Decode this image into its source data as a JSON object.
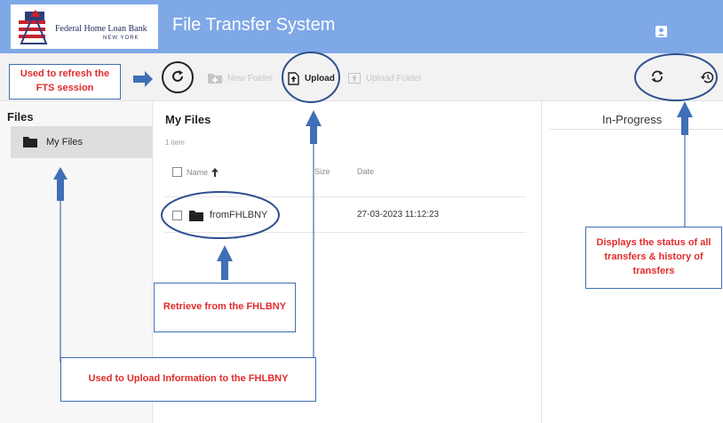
{
  "header": {
    "logo_name": "Federal Home Loan Bank",
    "logo_sub": "NEW YORK",
    "app_title": "File Transfer System",
    "user_icon": "user-account-icon"
  },
  "toolbar": {
    "refresh_icon": "refresh-icon",
    "new_folder_label": "New Folder",
    "upload_label": "Upload",
    "upload_folder_label": "Upload Folder",
    "in_progress_icon": "sync-icon",
    "history_icon": "history-icon"
  },
  "sidebar": {
    "title": "Files",
    "items": [
      {
        "label": "My Files",
        "icon": "folder-icon"
      }
    ]
  },
  "main": {
    "title": "My Files",
    "item_count": "1 item",
    "columns": {
      "name": "Name",
      "size": "Size",
      "date": "Date"
    },
    "sort_indicator": "arrow-up-icon",
    "rows": [
      {
        "name": "fromFHLBNY",
        "date": "27-03-2023 11:12:23",
        "icon": "folder-icon"
      }
    ]
  },
  "right_panel": {
    "title": "In-Progress"
  },
  "annotations": {
    "refresh": "Used to refresh the FTS session",
    "retrieve": "Retrieve from the FHLBNY",
    "upload": "Used to Upload Information to the FHLBNY",
    "status": "Displays the status of all transfers & history of transfers"
  },
  "colors": {
    "header_bg": "#7fa8e6",
    "annotation_text": "#e12c2c",
    "annotation_arrow": "#3f6fb6",
    "annotation_ring": "#2f4f8f"
  }
}
